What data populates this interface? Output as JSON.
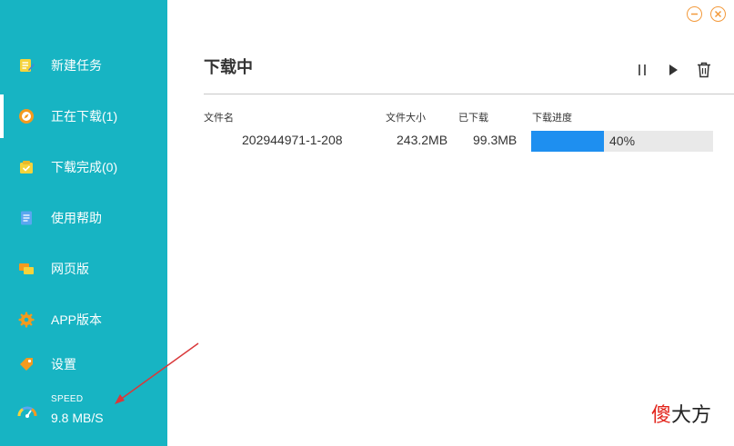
{
  "sidebar": {
    "items": [
      {
        "label": "新建任务",
        "icon": "new-task-icon"
      },
      {
        "label": "正在下载(1)",
        "icon": "compass-icon"
      },
      {
        "label": "下载完成(0)",
        "icon": "completed-icon"
      },
      {
        "label": "使用帮助",
        "icon": "help-doc-icon"
      },
      {
        "label": "网页版",
        "icon": "web-chat-icon"
      },
      {
        "label": "APP版本",
        "icon": "app-gear-icon"
      },
      {
        "label": "设置",
        "icon": "settings-tag-icon"
      }
    ],
    "speed": {
      "label": "SPEED",
      "value": "9.8 MB/S"
    }
  },
  "main": {
    "title": "下载中",
    "toolbar": {
      "pause": "pause-icon",
      "play": "play-icon",
      "delete": "trash-icon"
    },
    "columns": [
      "文件名",
      "文件大小",
      "已下载",
      "下载进度"
    ],
    "rows": [
      {
        "name": "202944971-1-208",
        "size": "243.2MB",
        "downloaded": "99.3MB",
        "progress": 0.4,
        "progress_label": "40%"
      }
    ]
  },
  "watermark": {
    "first": "傻",
    "rest": "大方"
  },
  "colors": {
    "sidebar": "#17b4c3",
    "progress": "#1e8ff0",
    "window_buttons": "#f39a3c",
    "arrow": "#d9383a"
  }
}
